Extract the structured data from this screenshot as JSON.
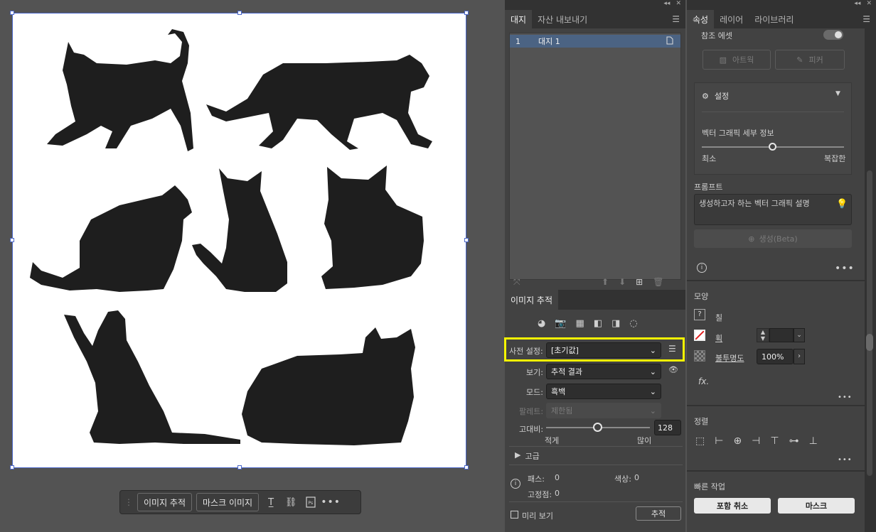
{
  "context_bar": {
    "image_trace_label": "이미지 추적",
    "mask_image_label": "마스크 이미지"
  },
  "artboards_panel": {
    "tabs": [
      "대지",
      "자산 내보내기"
    ],
    "rows": [
      {
        "index": "1",
        "name": "대지 1"
      }
    ]
  },
  "image_trace": {
    "title": "이미지 추적",
    "preset_label": "사전 설정:",
    "preset_value": "[초기값]",
    "view_label": "보기:",
    "view_value": "추적 결과",
    "mode_label": "모드:",
    "mode_value": "흑백",
    "palette_label": "팔레트:",
    "palette_value": "제한됨",
    "threshold_label": "고대비:",
    "threshold_value": "128",
    "threshold_min": "적게",
    "threshold_max": "많이",
    "advanced_label": "고급",
    "paths_label": "패스:",
    "paths_value": "0",
    "colors_label": "색상:",
    "colors_value": "0",
    "anchors_label": "고정점:",
    "anchors_value": "0",
    "preview_label": "미리 보기",
    "trace_button": "추적"
  },
  "properties_panel": {
    "tabs": [
      "속성",
      "레이어",
      "라이브러리"
    ],
    "reference_asset_label": "참조 에셋",
    "artwork_label": "아트웍",
    "picker_label": "피커",
    "settings_label": "설정",
    "detail_label": "벡터 그래픽 세부 정보",
    "detail_min": "최소",
    "detail_max": "복잡한",
    "prompt_label": "프롬프트",
    "prompt_placeholder": "생성하고자 하는 벡터 그래픽 설명",
    "generate_label": "생성(Beta)",
    "appearance_title": "모양",
    "fill_label": "칠",
    "stroke_label": "획",
    "opacity_label": "불투명도",
    "opacity_value": "100%",
    "fx_label": "fx.",
    "align_title": "정렬",
    "quick_actions_title": "빠른 작업",
    "release_group_label": "포함 취소",
    "mask_label": "마스크"
  },
  "colors": {
    "highlight": "#f5f500",
    "selection": "#4a66c8",
    "artboard_row": "#4b6383"
  }
}
